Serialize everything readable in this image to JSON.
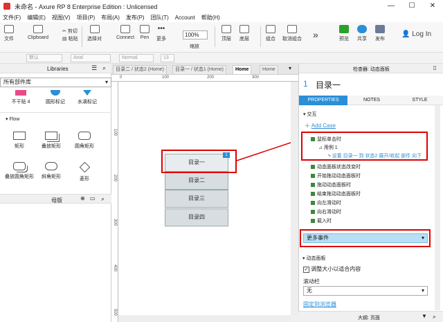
{
  "window": {
    "title": "未命名 - Axure RP 8 Enterprise Edition : Unlicensed",
    "minimize": "—",
    "maximize": "☐",
    "close": "✕"
  },
  "menu": [
    "文件(F)",
    "编辑(E)",
    "视图(V)",
    "项目(P)",
    "布局(A)",
    "发布(P)",
    "团队(T)",
    "Account",
    "帮助(H)"
  ],
  "toolbar": {
    "file": "文件",
    "clipboard": "Clipboard",
    "cut": "剪切",
    "paste": "粘贴",
    "select_mode": "选择对",
    "connect": "Connect",
    "pen": "Pen",
    "more": "更多",
    "zoom": "100%",
    "zoom_label": "缩放",
    "top": "顶层",
    "bottom": "底层",
    "group": "组合",
    "ungroup": "取消组合",
    "preview": "预览",
    "share": "共享",
    "publish": "发布",
    "login": "Log In"
  },
  "formatbar": {
    "style": "默认",
    "font": "Arial",
    "weight": "Normal",
    "size": "13"
  },
  "leftpanel": {
    "libraries_title": "Libraries",
    "library_select": "所有部件库",
    "row1": [
      "不干贴 4",
      "圆形标记",
      "水滴标记"
    ],
    "flow_section": "Flow",
    "flow_row1": [
      "矩形",
      "叠放矩形",
      "圆角矩形"
    ],
    "flow_row2": [
      "叠放圆角矩形",
      "斜角矩形",
      "菱形"
    ],
    "masters_title": "母版"
  },
  "tabs": [
    "目录二 / 状态2 (Home)",
    "目录一 / 状态1 (Home)",
    "Home",
    "Home"
  ],
  "rulers": {
    "top": [
      "0",
      "100",
      "200",
      "300"
    ],
    "left": [
      "100",
      "200",
      "300",
      "400",
      "500"
    ]
  },
  "canvas": {
    "items": [
      "目录一",
      "目录二",
      "目录三",
      "目录四"
    ],
    "badge": "1"
  },
  "rightpanel": {
    "inspector_title": "检查器: 动态面板",
    "number": "1",
    "name": "目录一",
    "tab_properties": "PROPERTIES",
    "tab_notes": "NOTES",
    "tab_style": "STYLE",
    "interaction_section": "交互",
    "add_case": "Add Case",
    "event_click": "鼠标单击时",
    "case1": "用例 1",
    "action": "设置 目录一 到 状态2 展开/收起 部件 向下",
    "events": [
      "动态面板状态改变时",
      "开始拖动动态面板时",
      "拖动动态面板时",
      "结束拖动动态面板时",
      "向左滑动时",
      "向右滑动时",
      "载入时"
    ],
    "more_events": "更多事件",
    "panel_section": "动态面板",
    "fit_content": "调整大小以适合内容",
    "scrollbar_label": "滚动栏",
    "scrollbar_value": "无",
    "pin_browser": "固定到浏览器",
    "bottom_label": "大纲: 页面"
  },
  "colors": {
    "accent": "#2a8fd6",
    "highlight": "#d00000",
    "event_green": "#3a8a3a"
  }
}
